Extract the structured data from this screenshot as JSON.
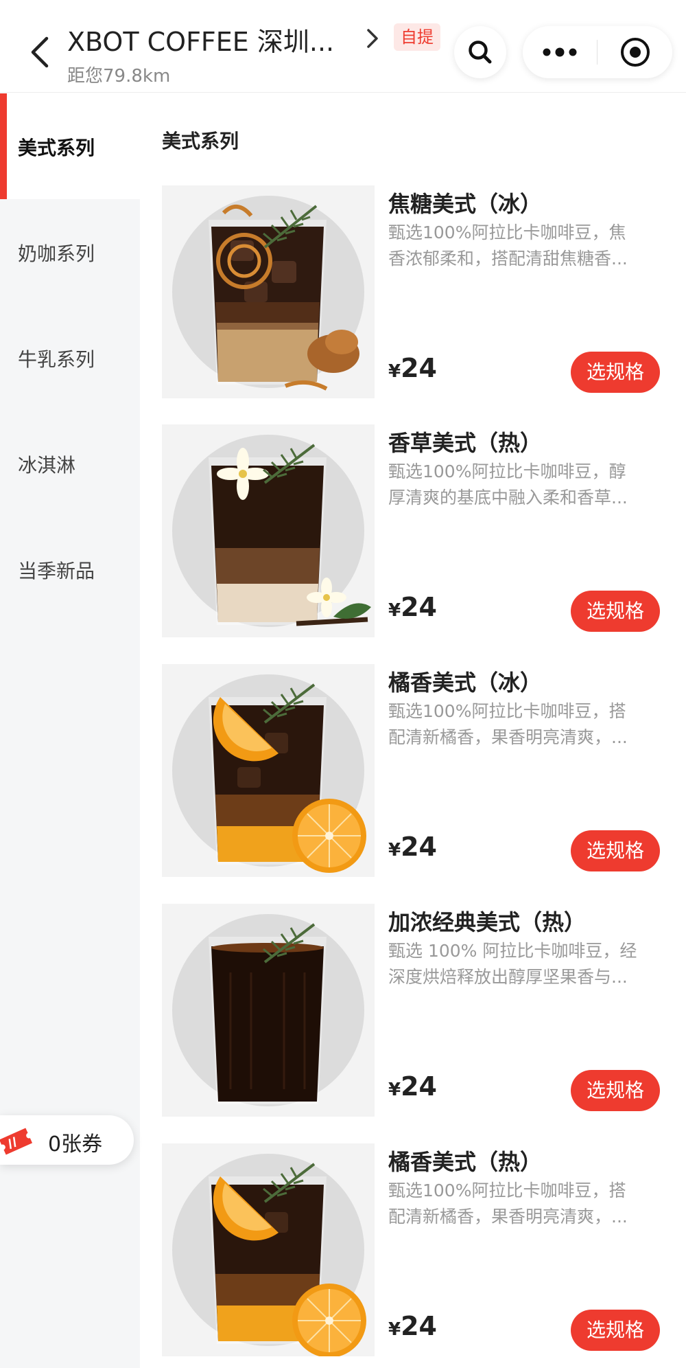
{
  "header": {
    "store_name": "XBOT COFFEE 深圳...",
    "pickup_tag": "自提",
    "distance": "距您79.8km"
  },
  "sidebar": {
    "items": [
      {
        "label": "美式系列",
        "active": true
      },
      {
        "label": "奶咖系列",
        "active": false
      },
      {
        "label": "牛乳系列",
        "active": false
      },
      {
        "label": "冰淇淋",
        "active": false
      },
      {
        "label": "当季新品",
        "active": false
      }
    ],
    "coupon": "0张券"
  },
  "main": {
    "section_title": "美式系列",
    "products": [
      {
        "name": "焦糖美式（冰）",
        "desc1": "甄选100%阿拉比卡咖啡豆，焦",
        "desc2": "香浓郁柔和，搭配清甜焦糖香...",
        "currency": "¥",
        "price": "24",
        "button": "选规格"
      },
      {
        "name": "香草美式（热）",
        "desc1": "甄选100%阿拉比卡咖啡豆，醇",
        "desc2": "厚清爽的基底中融入柔和香草...",
        "currency": "¥",
        "price": "24",
        "button": "选规格"
      },
      {
        "name": "橘香美式（冰）",
        "desc1": "甄选100%阿拉比卡咖啡豆，搭",
        "desc2": "配清新橘香，果香明亮清爽，...",
        "currency": "¥",
        "price": "24",
        "button": "选规格"
      },
      {
        "name": "加浓经典美式（热）",
        "desc1": "甄选 100% 阿拉比卡咖啡豆，经",
        "desc2": "深度烘焙释放出醇厚坚果香与...",
        "currency": "¥",
        "price": "24",
        "button": "选规格"
      },
      {
        "name": "橘香美式（热）",
        "desc1": "甄选100%阿拉比卡咖啡豆，搭",
        "desc2": "配清新橘香，果香明亮清爽，...",
        "currency": "¥",
        "price": "24",
        "button": "选规格"
      }
    ]
  },
  "colors": {
    "accent": "#ee3b2f",
    "sidebar_bg": "#f5f6f7",
    "desc_text": "#999999"
  },
  "icons": [
    "back-arrow-icon",
    "chevron-right-icon",
    "search-icon",
    "more-icon",
    "target-icon",
    "coupon-ticket-icon"
  ]
}
